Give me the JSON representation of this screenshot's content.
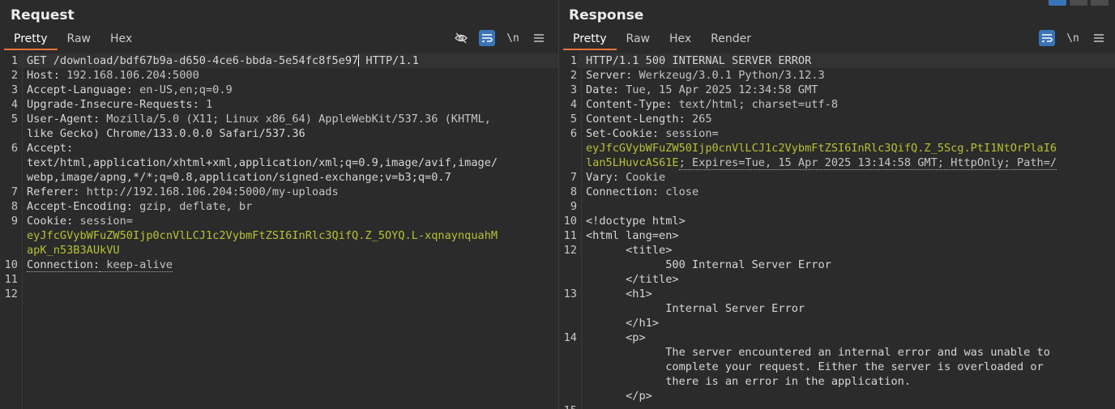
{
  "request": {
    "title": "Request",
    "tabs": [
      "Pretty",
      "Raw",
      "Hex"
    ],
    "toolbar": {
      "hide_icon": "eye-slash-icon",
      "wrap_icon": "wrap-icon",
      "newline_label": "\\n",
      "menu_icon": "menu-icon"
    },
    "lines": [
      {
        "n": "1",
        "text": "GET /download/bdf67b9a-d650-4ce6-bbda-5e54fc8f5e97 HTTP/1.1"
      },
      {
        "n": "2",
        "key": "Host:",
        "val": " 192.168.106.204:5000"
      },
      {
        "n": "3",
        "key": "Accept-Language:",
        "val": " en-US,en;q=0.9"
      },
      {
        "n": "4",
        "key": "Upgrade-Insecure-Requests:",
        "val": " 1"
      },
      {
        "n": "5",
        "key": "User-Agent:",
        "val": " Mozilla/5.0 (X11; Linux x86_64) AppleWebKit/537.36 (KHTML,"
      },
      {
        "n": "",
        "text": "like Gecko) Chrome/133.0.0.0 Safari/537.36"
      },
      {
        "n": "6",
        "key": "Accept:",
        "val": ""
      },
      {
        "n": "",
        "text": "text/html,application/xhtml+xml,application/xml;q=0.9,image/avif,image/"
      },
      {
        "n": "",
        "text": "webp,image/apng,*/*;q=0.8,application/signed-exchange;v=b3;q=0.7"
      },
      {
        "n": "7",
        "key": "Referer:",
        "val": " http://192.168.106.204:5000/my-uploads"
      },
      {
        "n": "8",
        "key": "Accept-Encoding:",
        "val": " gzip, deflate, br"
      },
      {
        "n": "9",
        "key": "Cookie:",
        "val": " session="
      },
      {
        "n": "",
        "tok": "eyJfcGVybWFuZW50Ijp0cnVlLCJ1c2VybmFtZSI6InRlc3QifQ.Z_5OYQ.L-xqnaynquahM"
      },
      {
        "n": "",
        "tok": "apK_n53B3AUkVU"
      },
      {
        "n": "10",
        "key": "Connection:",
        "val": " keep-alive"
      },
      {
        "n": "11",
        "text": ""
      },
      {
        "n": "12",
        "text": ""
      }
    ]
  },
  "response": {
    "title": "Response",
    "tabs": [
      "Pretty",
      "Raw",
      "Hex",
      "Render"
    ],
    "toolbar": {
      "wrap_icon": "wrap-icon",
      "newline_label": "\\n",
      "menu_icon": "menu-icon"
    },
    "lines": [
      {
        "n": "1",
        "text": "HTTP/1.1 500 INTERNAL SERVER ERROR"
      },
      {
        "n": "2",
        "key": "Server:",
        "val": " Werkzeug/3.0.1 Python/3.12.3"
      },
      {
        "n": "3",
        "key": "Date:",
        "val": " Tue, 15 Apr 2025 12:34:58 GMT"
      },
      {
        "n": "4",
        "key": "Content-Type:",
        "val": " text/html; charset=utf-8"
      },
      {
        "n": "5",
        "key": "Content-Length:",
        "val": " 265"
      },
      {
        "n": "6",
        "key": "Set-Cookie:",
        "val": " session="
      },
      {
        "n": "",
        "tok": "eyJfcGVybWFuZW50Ijp0cnVlLCJ1c2VybmFtZSI6InRlc3QifQ.Z_5Scg.PtI1NtOrPlaI6"
      },
      {
        "n": "",
        "tok": "lan5LHuvcAS61E",
        "val": "; Expires=Tue, 15 Apr 2025 13:14:58 GMT; HttpOnly; Path=/"
      },
      {
        "n": "7",
        "key": "Vary:",
        "val": " Cookie"
      },
      {
        "n": "8",
        "key": "Connection:",
        "val": " close"
      },
      {
        "n": "9",
        "text": ""
      },
      {
        "n": "10",
        "text": "<!doctype html>"
      },
      {
        "n": "11",
        "text": "<html lang=en>"
      },
      {
        "n": "12",
        "text": "      <title>"
      },
      {
        "n": "",
        "text": "            500 Internal Server Error"
      },
      {
        "n": "",
        "text": "      </title>"
      },
      {
        "n": "13",
        "text": "      <h1>"
      },
      {
        "n": "",
        "text": "            Internal Server Error"
      },
      {
        "n": "",
        "text": "      </h1>"
      },
      {
        "n": "14",
        "text": "      <p>"
      },
      {
        "n": "",
        "text": "            The server encountered an internal error and was unable to"
      },
      {
        "n": "",
        "text": "            complete your request. Either the server is overloaded or"
      },
      {
        "n": "",
        "text": "            there is an error in the application."
      },
      {
        "n": "",
        "text": "      </p>"
      },
      {
        "n": "15",
        "text": ""
      }
    ]
  }
}
